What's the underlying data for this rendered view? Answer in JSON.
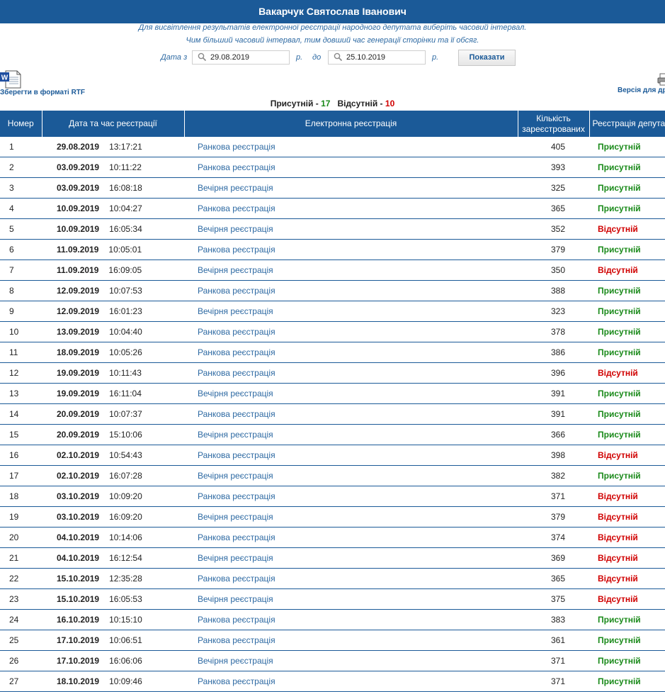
{
  "header": {
    "title": "Вакарчук Святослав Іванович"
  },
  "info": {
    "line1": "Для висвітлення результатів електронної реєстрації народного депутата виберіть часовий інтервал.",
    "line2": "Чим більший часовий інтервал, тим довший час генерації сторінки та її обсяг."
  },
  "filter": {
    "from_label": "Дата з",
    "from_value": "29.08.2019",
    "from_suffix": "р.",
    "to_label": "до",
    "to_value": "25.10.2019",
    "to_suffix": "р.",
    "show_button": "Показати",
    "search_icon": "magnifier-icon"
  },
  "toolbar": {
    "rtf_label": "Зберегти в форматі RTF",
    "rtf_icon": "word-document-icon",
    "print_label": "Версія для друку",
    "print_icon": "printer-icon"
  },
  "summary": {
    "present_label": "Присутній -",
    "present_count": "17",
    "absent_label": "Відсутній -",
    "absent_count": "10"
  },
  "colors": {
    "header_bg": "#1b5a98",
    "link": "#2e6aa3",
    "present": "#1a8a1a",
    "absent": "#d00000"
  },
  "table": {
    "headers": {
      "num": "Номер",
      "datetime": "Дата та час реєстрації",
      "reg": "Електронна реєстрація",
      "count": "Кількість зареєстрованих",
      "status": "Реєстрація депутата"
    },
    "rows": [
      {
        "num": "1",
        "date": "29.08.2019",
        "time": "13:17:21",
        "reg": "Ранкова реєстрація",
        "count": "405",
        "status": "Присутній",
        "present": true
      },
      {
        "num": "2",
        "date": "03.09.2019",
        "time": "10:11:22",
        "reg": "Ранкова реєстрація",
        "count": "393",
        "status": "Присутній",
        "present": true
      },
      {
        "num": "3",
        "date": "03.09.2019",
        "time": "16:08:18",
        "reg": "Вечірня реєстрація",
        "count": "325",
        "status": "Присутній",
        "present": true
      },
      {
        "num": "4",
        "date": "10.09.2019",
        "time": "10:04:27",
        "reg": "Ранкова реєстрація",
        "count": "365",
        "status": "Присутній",
        "present": true
      },
      {
        "num": "5",
        "date": "10.09.2019",
        "time": "16:05:34",
        "reg": "Вечірня реєстрація",
        "count": "352",
        "status": "Відсутній",
        "present": false
      },
      {
        "num": "6",
        "date": "11.09.2019",
        "time": "10:05:01",
        "reg": "Ранкова реєстрація",
        "count": "379",
        "status": "Присутній",
        "present": true
      },
      {
        "num": "7",
        "date": "11.09.2019",
        "time": "16:09:05",
        "reg": "Вечірня реєстрація",
        "count": "350",
        "status": "Відсутній",
        "present": false
      },
      {
        "num": "8",
        "date": "12.09.2019",
        "time": "10:07:53",
        "reg": "Ранкова реєстрація",
        "count": "388",
        "status": "Присутній",
        "present": true
      },
      {
        "num": "9",
        "date": "12.09.2019",
        "time": "16:01:23",
        "reg": "Вечірня реєстрація",
        "count": "323",
        "status": "Присутній",
        "present": true
      },
      {
        "num": "10",
        "date": "13.09.2019",
        "time": "10:04:40",
        "reg": "Ранкова реєстрація",
        "count": "378",
        "status": "Присутній",
        "present": true
      },
      {
        "num": "11",
        "date": "18.09.2019",
        "time": "10:05:26",
        "reg": "Ранкова реєстрація",
        "count": "386",
        "status": "Присутній",
        "present": true
      },
      {
        "num": "12",
        "date": "19.09.2019",
        "time": "10:11:43",
        "reg": "Ранкова реєстрація",
        "count": "396",
        "status": "Відсутній",
        "present": false
      },
      {
        "num": "13",
        "date": "19.09.2019",
        "time": "16:11:04",
        "reg": "Вечірня реєстрація",
        "count": "391",
        "status": "Присутній",
        "present": true
      },
      {
        "num": "14",
        "date": "20.09.2019",
        "time": "10:07:37",
        "reg": "Ранкова реєстрація",
        "count": "391",
        "status": "Присутній",
        "present": true
      },
      {
        "num": "15",
        "date": "20.09.2019",
        "time": "15:10:06",
        "reg": "Вечірня реєстрація",
        "count": "366",
        "status": "Присутній",
        "present": true
      },
      {
        "num": "16",
        "date": "02.10.2019",
        "time": "10:54:43",
        "reg": "Ранкова реєстрація",
        "count": "398",
        "status": "Відсутній",
        "present": false
      },
      {
        "num": "17",
        "date": "02.10.2019",
        "time": "16:07:28",
        "reg": "Вечірня реєстрація",
        "count": "382",
        "status": "Присутній",
        "present": true
      },
      {
        "num": "18",
        "date": "03.10.2019",
        "time": "10:09:20",
        "reg": "Ранкова реєстрація",
        "count": "371",
        "status": "Відсутній",
        "present": false
      },
      {
        "num": "19",
        "date": "03.10.2019",
        "time": "16:09:20",
        "reg": "Вечірня реєстрація",
        "count": "379",
        "status": "Відсутній",
        "present": false
      },
      {
        "num": "20",
        "date": "04.10.2019",
        "time": "10:14:06",
        "reg": "Ранкова реєстрація",
        "count": "374",
        "status": "Відсутній",
        "present": false
      },
      {
        "num": "21",
        "date": "04.10.2019",
        "time": "16:12:54",
        "reg": "Вечірня реєстрація",
        "count": "369",
        "status": "Відсутній",
        "present": false
      },
      {
        "num": "22",
        "date": "15.10.2019",
        "time": "12:35:28",
        "reg": "Ранкова реєстрація",
        "count": "365",
        "status": "Відсутній",
        "present": false
      },
      {
        "num": "23",
        "date": "15.10.2019",
        "time": "16:05:53",
        "reg": "Вечірня реєстрація",
        "count": "375",
        "status": "Відсутній",
        "present": false
      },
      {
        "num": "24",
        "date": "16.10.2019",
        "time": "10:15:10",
        "reg": "Ранкова реєстрація",
        "count": "383",
        "status": "Присутній",
        "present": true
      },
      {
        "num": "25",
        "date": "17.10.2019",
        "time": "10:06:51",
        "reg": "Ранкова реєстрація",
        "count": "361",
        "status": "Присутній",
        "present": true
      },
      {
        "num": "26",
        "date": "17.10.2019",
        "time": "16:06:06",
        "reg": "Вечірня реєстрація",
        "count": "371",
        "status": "Присутній",
        "present": true
      },
      {
        "num": "27",
        "date": "18.10.2019",
        "time": "10:09:46",
        "reg": "Ранкова реєстрація",
        "count": "371",
        "status": "Присутній",
        "present": true
      }
    ]
  }
}
